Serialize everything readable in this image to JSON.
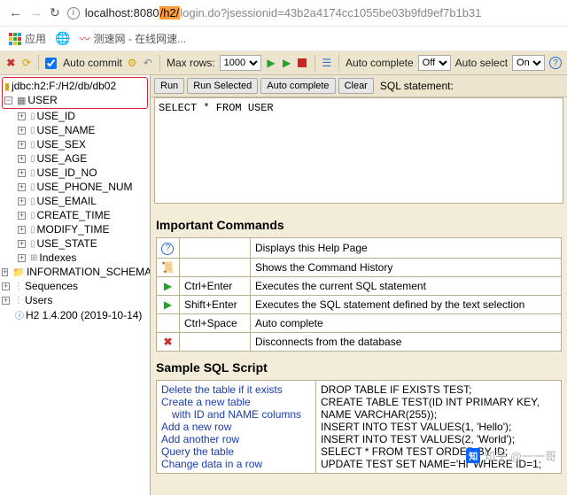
{
  "browser": {
    "url_host": "localhost",
    "url_port": ":8080",
    "url_hl": "/h2/",
    "url_path": "login.do?jsessionid=43b2a4174cc1055be03b9fd9ef7b1b31"
  },
  "bookmarks": {
    "apps_label": "应用",
    "item1_label": "测速网 - 在线网速..."
  },
  "toolbar": {
    "auto_commit_label": "Auto commit",
    "max_rows_label": "Max rows:",
    "max_rows_value": "1000",
    "auto_complete_label": "Auto complete",
    "auto_complete_value": "Off",
    "auto_select_label": "Auto select",
    "auto_select_value": "On"
  },
  "tree": {
    "conn": "jdbc:h2:F:/H2/db/db02",
    "user_table": "USER",
    "cols": [
      "USE_ID",
      "USE_NAME",
      "USE_SEX",
      "USE_AGE",
      "USE_ID_NO",
      "USE_PHONE_NUM",
      "USE_EMAIL",
      "CREATE_TIME",
      "MODIFY_TIME",
      "USE_STATE"
    ],
    "indexes": "Indexes",
    "info_schema": "INFORMATION_SCHEMA",
    "sequences": "Sequences",
    "users": "Users",
    "version": "H2 1.4.200 (2019-10-14)"
  },
  "runbar": {
    "run": "Run",
    "run_selected": "Run Selected",
    "auto_complete": "Auto complete",
    "clear": "Clear",
    "sql_stmt_label": "SQL statement:"
  },
  "sql": "SELECT * FROM USER",
  "important_commands_title": "Important Commands",
  "commands": [
    {
      "icon": "help",
      "kb": "",
      "desc": "Displays this Help Page"
    },
    {
      "icon": "hist",
      "kb": "",
      "desc": "Shows the Command History"
    },
    {
      "icon": "play",
      "kb": "Ctrl+Enter",
      "desc": "Executes the current SQL statement"
    },
    {
      "icon": "playsel",
      "kb": "Shift+Enter",
      "desc": "Executes the SQL statement defined by the text selection"
    },
    {
      "icon": "",
      "kb": "Ctrl+Space",
      "desc": "Auto complete"
    },
    {
      "icon": "disc",
      "kb": "",
      "desc": "Disconnects from the database"
    }
  ],
  "sample_title": "Sample SQL Script",
  "scripts": [
    {
      "desc": "Delete the table if it exists",
      "sql": "DROP TABLE IF EXISTS TEST;"
    },
    {
      "desc": "Create a new table",
      "desc2": "with ID and NAME columns",
      "sql": "CREATE TABLE TEST(ID INT PRIMARY KEY,\n   NAME VARCHAR(255));"
    },
    {
      "desc": "Add a new row",
      "sql": "INSERT INTO TEST VALUES(1, 'Hello');"
    },
    {
      "desc": "Add another row",
      "sql": "INSERT INTO TEST VALUES(2, 'World');"
    },
    {
      "desc": "Query the table",
      "sql": "SELECT * FROM TEST ORDER BY ID;"
    },
    {
      "desc": "Change data in a row",
      "sql": "UPDATE TEST SET NAME='Hi' WHERE ID=1;"
    }
  ],
  "watermark": "知乎 @一一哥"
}
